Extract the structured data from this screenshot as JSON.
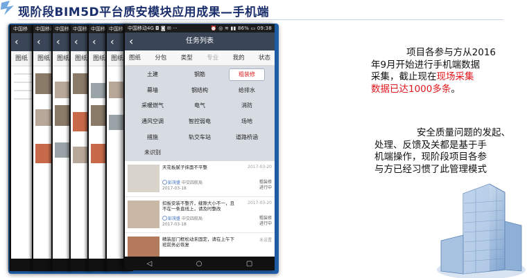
{
  "slide": {
    "title": "现阶段BIM5D平台质安模块应用成果—手机端",
    "para1_line1": "项目各参与方从2016",
    "para1_line2": "年9月开始进行手机端数据",
    "para1_line3_pre": "采集，截止现在",
    "para1_line3_red": "现场采集",
    "para1_line4_red": "数据已达1000多条",
    "para1_line4_post": "。",
    "para2_line1": "安全质量问题的发起、",
    "para2_line2": "处理、反馈及关都是基于手",
    "para2_line3": "机端操作，现阶段项目各参",
    "para2_line4": "与方已经习惯了此管理模式"
  },
  "back_phones": [
    {
      "status": "中国移",
      "tab": "图纸"
    },
    {
      "status": "中国移动",
      "tab": "图纸"
    },
    {
      "status": "中国移动",
      "tab": "图纸"
    },
    {
      "status": "中国移",
      "tab": "图纸"
    },
    {
      "status": "中国移动4G",
      "tab": "图纸"
    }
  ],
  "phone": {
    "status_left": "中国移动4G ◘ ◙ ✉ ···",
    "status_right": "⏰ ◎ ≋ ▮▮ 86% ▭ 09:38",
    "title": "任务列表",
    "back_glyph": "‹",
    "tabs": [
      "图纸",
      "分包",
      "类型",
      "专业",
      "我的",
      "状态"
    ],
    "active_tab_index": 3,
    "categories": [
      "土建",
      "钢筋",
      "粗装修",
      "幕墙",
      "钢结构",
      "给排水",
      "采暖燃气",
      "电气",
      "消防",
      "通风空调",
      "智控弱电",
      "场地",
      "措施",
      "轨交车站",
      "道路桥涵",
      "未识别",
      "",
      ""
    ],
    "selected_category": "粗装修",
    "items": [
      {
        "desc": "天花板腻子抹面不平整",
        "date": "2017-03-20",
        "user": "彭茂盛",
        "org": "中交四航局",
        "date2": "2017-03-18",
        "category": "粗装修",
        "status": "进行中",
        "thumb_color": "#d8d4cc"
      },
      {
        "desc": "扣板安装不整齐，缝隙大小不一，且不在一条直线上，请及时整改",
        "date": "2017-03-20",
        "user": "彭茂盛",
        "org": "中交四航局",
        "date2": "2017-03-18",
        "category": "粗装修",
        "status": "进行中",
        "thumb_color": "#c9b8a6"
      },
      {
        "desc": "精装层门框松动未固定，请在上午下班前务必恢复",
        "date": "未设置",
        "user": "",
        "org": "",
        "date2": "",
        "category": "",
        "status": "",
        "thumb_color": "#b47a5e"
      }
    ],
    "nav": [
      "◁",
      "○",
      "▢"
    ]
  }
}
